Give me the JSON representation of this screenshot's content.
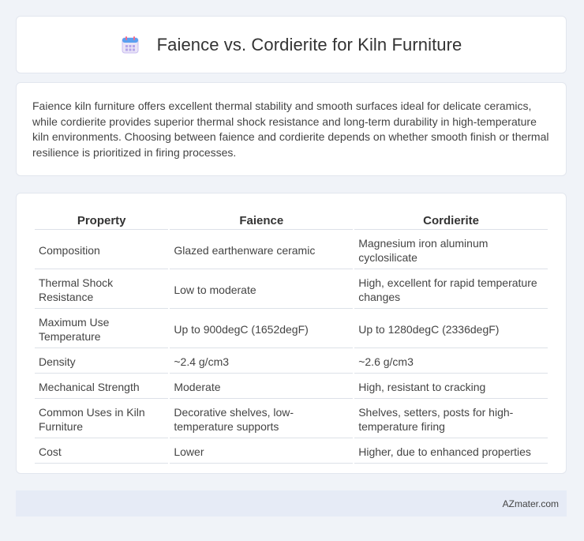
{
  "header": {
    "title": "Faience vs. Cordierite for Kiln Furniture",
    "icon": "calendar-icon"
  },
  "intro": {
    "text": "Faience kiln furniture offers excellent thermal stability and smooth surfaces ideal for delicate ceramics, while cordierite provides superior thermal shock resistance and long-term durability in high-temperature kiln environments. Choosing between faience and cordierite depends on whether smooth finish or thermal resilience is prioritized in firing processes."
  },
  "table": {
    "headers": [
      "Property",
      "Faience",
      "Cordierite"
    ],
    "rows": [
      [
        "Composition",
        "Glazed earthenware ceramic",
        "Magnesium iron aluminum cyclosilicate"
      ],
      [
        "Thermal Shock Resistance",
        "Low to moderate",
        "High, excellent for rapid temperature changes"
      ],
      [
        "Maximum Use Temperature",
        "Up to 900degC (1652degF)",
        "Up to 1280degC (2336degF)"
      ],
      [
        "Density",
        "~2.4 g/cm3",
        "~2.6 g/cm3"
      ],
      [
        "Mechanical Strength",
        "Moderate",
        "High, resistant to cracking"
      ],
      [
        "Common Uses in Kiln Furniture",
        "Decorative shelves, low-temperature supports",
        "Shelves, setters, posts for high-temperature firing"
      ],
      [
        "Cost",
        "Lower",
        "Higher, due to enhanced properties"
      ]
    ]
  },
  "footer": {
    "brand": "AZmater.com"
  }
}
